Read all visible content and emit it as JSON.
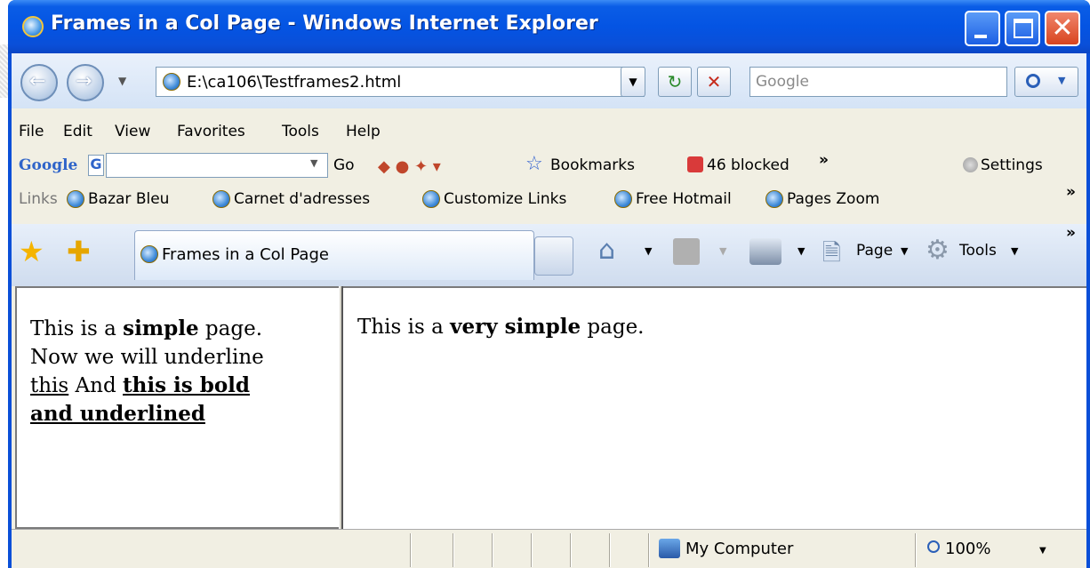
{
  "window": {
    "title": "Frames in a Col Page - Windows Internet Explorer"
  },
  "address": {
    "url": "E:\\ca106\\Testframes2.html"
  },
  "search": {
    "placeholder": "Google"
  },
  "menu": [
    "File",
    "Edit",
    "View",
    "Favorites",
    "Tools",
    "Help"
  ],
  "google_toolbar": {
    "logo": "Google",
    "go": "Go",
    "bookmarks": "Bookmarks",
    "blocked": "46 blocked",
    "more": "»",
    "settings": "Settings"
  },
  "links_bar": {
    "label": "Links",
    "items": [
      "Bazar Bleu",
      "Carnet d'adresses",
      "Customize Links",
      "Free Hotmail",
      "Pages Zoom"
    ],
    "more": "»"
  },
  "tabs": {
    "active_title": "Frames in a Col Page"
  },
  "command_bar": {
    "page": "Page",
    "tools": "Tools",
    "more": "»"
  },
  "left_frame": {
    "t1": "This is a ",
    "b1": "simple",
    "t2": " page. Now we will underline ",
    "u1": "this",
    "t3": " And ",
    "bu1": "this is bold and underlined"
  },
  "right_frame": {
    "t1": "This is a ",
    "b1": "very simple",
    "t2": " page."
  },
  "status": {
    "zone": "My Computer",
    "zoom": "100%"
  },
  "colors": {
    "titlebar": "#0a4fd8",
    "close_button": "#d8441f",
    "chrome": "#f1efe3"
  }
}
